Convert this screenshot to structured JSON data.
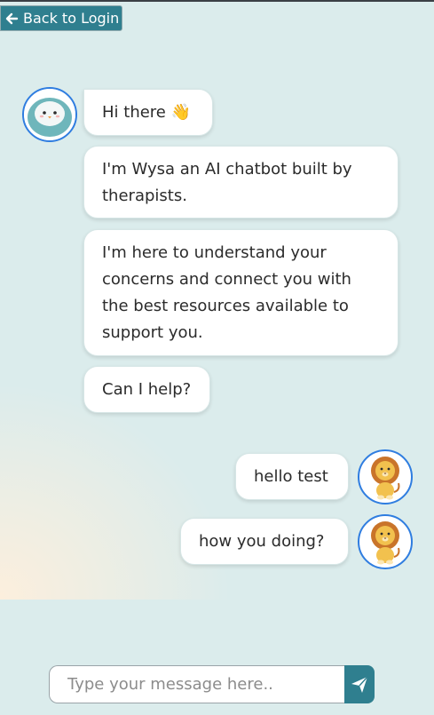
{
  "nav": {
    "back_label": "Back to Login"
  },
  "messages": [
    {
      "sender": "bot",
      "text": "Hi there 👋"
    },
    {
      "sender": "bot",
      "text": "I'm Wysa an AI chatbot built by therapists."
    },
    {
      "sender": "bot",
      "text": "I'm here to understand your concerns and connect you with the best resources available to support you."
    },
    {
      "sender": "bot",
      "text": "Can I help?"
    },
    {
      "sender": "user",
      "text": "hello test"
    },
    {
      "sender": "user",
      "text": "how you doing?"
    }
  ],
  "composer": {
    "placeholder": "Type your message here.."
  },
  "colors": {
    "accent": "#2f7f8f",
    "avatar_ring": "#2f7de0",
    "background": "#dbecec"
  },
  "icons": {
    "back": "arrow-left-icon",
    "send": "send-paper-plane-icon",
    "bot_avatar": "wysa-penguin-icon",
    "user_avatar": "lion-icon"
  }
}
